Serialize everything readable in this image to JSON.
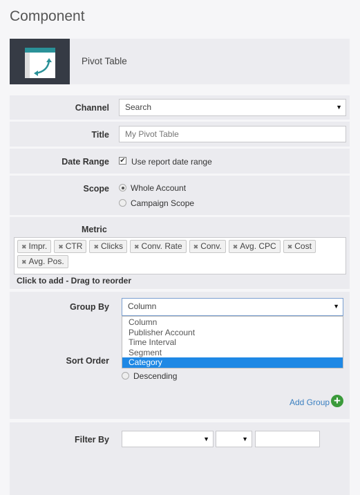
{
  "title": "Component",
  "component": {
    "name": "Pivot Table",
    "icon": "pivot-table-icon"
  },
  "channel": {
    "label": "Channel",
    "value": "Search"
  },
  "title_field": {
    "label": "Title",
    "placeholder": "My Pivot Table"
  },
  "date_range": {
    "label": "Date Range",
    "checkbox_label": "Use report date range",
    "checked": true
  },
  "scope": {
    "label": "Scope",
    "options": [
      "Whole Account",
      "Campaign Scope"
    ],
    "selected": "Whole Account"
  },
  "metric": {
    "label": "Metric",
    "tags": [
      "Impr.",
      "CTR",
      "Clicks",
      "Conv. Rate",
      "Conv.",
      "Avg. CPC",
      "Cost",
      "Avg. Pos."
    ],
    "hint": "Click to add - Drag to reorder"
  },
  "group_by": {
    "label": "Group By",
    "value": "Column",
    "options": [
      "Column",
      "Publisher Account",
      "Time Interval",
      "Segment",
      "Category"
    ],
    "highlighted": "Category"
  },
  "sort_order": {
    "label": "Sort Order",
    "visible_option": "Descending"
  },
  "add_group": "Add Group",
  "filter_by": {
    "label": "Filter By"
  },
  "colors": {
    "accent": "#1e88e5",
    "add": "#3a9a3a",
    "link": "#3a7fc0"
  }
}
